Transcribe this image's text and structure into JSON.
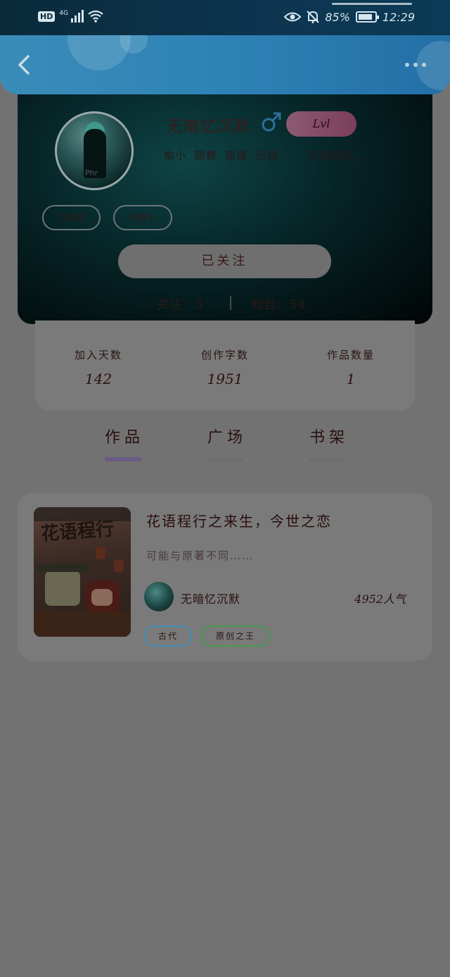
{
  "status_bar": {
    "hd": "HD",
    "network": "4G",
    "battery_percent": "85%",
    "time": "12:29",
    "battery_level": 0.85
  },
  "header": {
    "back_icon": "chevron-left-icon",
    "more_icon": "more-horizontal-icon"
  },
  "profile": {
    "username": "无暗忆沉默",
    "gender_icon": "male-icon",
    "level": "Lvl",
    "tags": "愉小 跳舞 跳播 远程",
    "tags_more": "还有很多……",
    "chips": [
      "文蝎读",
      "除情令"
    ],
    "follow_button": "已关注",
    "following": "关注：3",
    "followers": "粉丝：54"
  },
  "stats": [
    {
      "label": "加入天数",
      "value": "142"
    },
    {
      "label": "创作字数",
      "value": "1951"
    },
    {
      "label": "作品数量",
      "value": "1"
    }
  ],
  "tabs": [
    {
      "label": "作品",
      "active": true
    },
    {
      "label": "广场",
      "active": false
    },
    {
      "label": "书架",
      "active": false
    }
  ],
  "works": [
    {
      "cover_text": "花语程行",
      "title": "花语程行之来生，今世之恋",
      "desc": "可能与原著不同……",
      "author": "无暗忆沉默",
      "popularity": "4952人气",
      "tags": [
        "古代",
        "原创之王"
      ]
    }
  ],
  "colors": {
    "header_blue": "#2e82b6",
    "level_badge": "#8d5a74",
    "tab_indicator": "#6a5a86",
    "tag_blue": "#3f8fb8",
    "tag_green": "#4a9a4a"
  }
}
